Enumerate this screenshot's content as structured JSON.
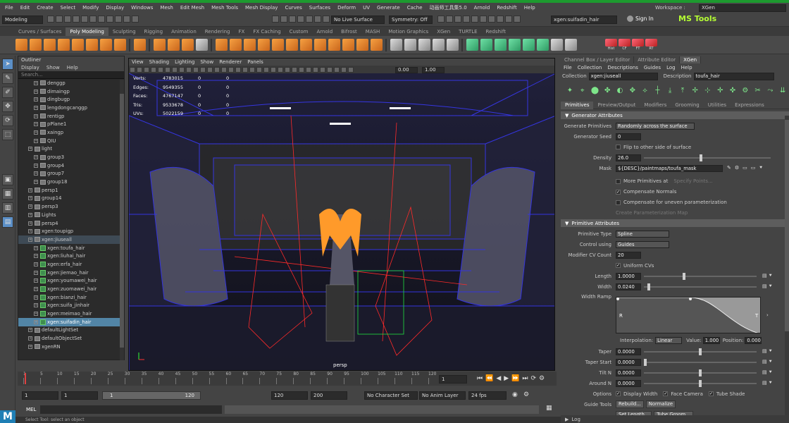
{
  "menubar": {
    "items": [
      "File",
      "Edit",
      "Create",
      "Select",
      "Modify",
      "Display",
      "Windows",
      "Mesh",
      "Edit Mesh",
      "Mesh Tools",
      "Mesh Display",
      "Curves",
      "Surfaces",
      "Deform",
      "UV",
      "Generate",
      "Cache",
      "动画师工具集5.0",
      "Arnold",
      "Redshift",
      "Help"
    ],
    "workspace_label": "Workspace :",
    "workspace_value": "XGen"
  },
  "statusline": {
    "mode": "Modeling",
    "live_surface": "No Live Surface",
    "symmetry": "Symmetry: Off",
    "search_field": "xgen:suifadin_hair",
    "sign_in": "Sign In",
    "brand": "MS Tools"
  },
  "shelf_tabs": [
    "Curves / Surfaces",
    "Poly Modeling",
    "Sculpting",
    "Rigging",
    "Animation",
    "Rendering",
    "FX",
    "FX Caching",
    "Custom",
    "Arnold",
    "Bifrost",
    "MASH",
    "Motion Graphics",
    "XGen",
    "TURTLE",
    "Redshift"
  ],
  "shelf_active": "Poly Modeling",
  "shelf_right_labels": [
    "Hist",
    "CF",
    "FT",
    "RT"
  ],
  "outliner": {
    "title": "Outliner",
    "menu": [
      "Display",
      "Show",
      "Help"
    ],
    "search_placeholder": "Search...",
    "items": [
      {
        "label": "denggp",
        "indent": 1,
        "kind": "group"
      },
      {
        "label": "dimaingp",
        "indent": 1,
        "kind": "group"
      },
      {
        "label": "dingbugp",
        "indent": 1,
        "kind": "group"
      },
      {
        "label": "lengdongcanggp",
        "indent": 1,
        "kind": "group"
      },
      {
        "label": "rentigp",
        "indent": 1,
        "kind": "group"
      },
      {
        "label": "pPlane1",
        "indent": 1,
        "kind": "group"
      },
      {
        "label": "xaingp",
        "indent": 1,
        "kind": "group"
      },
      {
        "label": "QIU",
        "indent": 1,
        "kind": "group"
      },
      {
        "label": "light",
        "indent": 0,
        "kind": "group"
      },
      {
        "label": "group3",
        "indent": 1,
        "kind": "group"
      },
      {
        "label": "group4",
        "indent": 1,
        "kind": "group"
      },
      {
        "label": "group7",
        "indent": 1,
        "kind": "group"
      },
      {
        "label": "group18",
        "indent": 1,
        "kind": "group"
      },
      {
        "label": "persp1",
        "indent": 0,
        "kind": "camera"
      },
      {
        "label": "group14",
        "indent": 0,
        "kind": "group"
      },
      {
        "label": "persp3",
        "indent": 0,
        "kind": "camera"
      },
      {
        "label": "Lights",
        "indent": 0,
        "kind": "group"
      },
      {
        "label": "persp4",
        "indent": 0,
        "kind": "camera"
      },
      {
        "label": "xgen:toupigp",
        "indent": 0,
        "kind": "group"
      },
      {
        "label": "xgen:jiuseall",
        "indent": 0,
        "kind": "group",
        "highlight": "soft"
      },
      {
        "label": "xgen:toufa_hair",
        "indent": 1,
        "kind": "xgen"
      },
      {
        "label": "xgen:liuhai_hair",
        "indent": 1,
        "kind": "xgen"
      },
      {
        "label": "xgen:erfa_hair",
        "indent": 1,
        "kind": "xgen"
      },
      {
        "label": "xgen:jiemao_hair",
        "indent": 1,
        "kind": "xgen"
      },
      {
        "label": "xgen:youmawei_hair",
        "indent": 1,
        "kind": "xgen"
      },
      {
        "label": "xgen:zuomawei_hair",
        "indent": 1,
        "kind": "xgen"
      },
      {
        "label": "xgen:bianzi_hair",
        "indent": 1,
        "kind": "xgen"
      },
      {
        "label": "xgen:suifa_jinhair",
        "indent": 1,
        "kind": "xgen"
      },
      {
        "label": "xgen:meimao_hair",
        "indent": 1,
        "kind": "xgen"
      },
      {
        "label": "xgen:suifadin_hair",
        "indent": 1,
        "kind": "xgen",
        "highlight": "sel"
      },
      {
        "label": "defaultLightSet",
        "indent": 0,
        "kind": "set"
      },
      {
        "label": "defaultObjectSet",
        "indent": 0,
        "kind": "set"
      },
      {
        "label": "xgenRN",
        "indent": 0,
        "kind": "ref"
      }
    ]
  },
  "viewport": {
    "menu": [
      "View",
      "Shading",
      "Lighting",
      "Show",
      "Renderer",
      "Panels"
    ],
    "field1": "0.00",
    "field2": "1.00",
    "hud": [
      {
        "label": "Verts:",
        "value": "4783015",
        "v2": "0",
        "v3": "0"
      },
      {
        "label": "Edges:",
        "value": "9549355",
        "v2": "0",
        "v3": "0"
      },
      {
        "label": "Faces:",
        "value": "4767147",
        "v2": "0",
        "v3": "0"
      },
      {
        "label": "Tris:",
        "value": "9533678",
        "v2": "0",
        "v3": "0"
      },
      {
        "label": "UVs:",
        "value": "5022159",
        "v2": "0",
        "v3": "0"
      }
    ],
    "camera_label": "persp"
  },
  "timeline": {
    "ticks": [
      "1",
      "5",
      "10",
      "15",
      "20",
      "25",
      "30",
      "35",
      "40",
      "45",
      "50",
      "55",
      "60",
      "65",
      "70",
      "75",
      "80",
      "85",
      "90",
      "95",
      "100",
      "105",
      "110",
      "115",
      "120"
    ],
    "current_frame": "1"
  },
  "range": {
    "start": "1",
    "start2": "1",
    "slider_left": "1",
    "slider_right": "120",
    "end": "120",
    "end2": "200",
    "character_set": "No Character Set",
    "anim_layer": "No Anim Layer",
    "fps": "24 fps"
  },
  "mel": {
    "label": "MEL"
  },
  "help_line": "Select Tool: select an object",
  "right_panel": {
    "tabs": [
      "Channel Box / Layer Editor",
      "Attribute Editor",
      "XGen"
    ],
    "active_tab": "XGen",
    "menu": [
      "File",
      "Collection",
      "Descriptions",
      "Guides",
      "Log",
      "Help"
    ],
    "collection_label": "Collection",
    "collection_value": "xgen:jiuseall",
    "description_label": "Description",
    "description_value": "toufa_hair",
    "subtabs": [
      "Primitives",
      "Preview/Output",
      "Modifiers",
      "Grooming",
      "Utilities",
      "Expressions"
    ],
    "active_subtab": "Primitives",
    "generator": {
      "section": "Generator Attributes",
      "generate_label": "Generate Primitives",
      "generate_value": "Randomly across the surface",
      "seed_label": "Generator Seed",
      "seed_value": "0",
      "flip_label": "Flip to other side of surface",
      "density_label": "Density",
      "density_value": "26.0",
      "density_fraction": 0.45,
      "mask_label": "Mask",
      "mask_value": "${DESC}/paintmaps/toufa_mask",
      "more_prims_label": "More Primitives at",
      "specify_points": "Specify Points...",
      "comp_normals_label": "Compensate Normals",
      "comp_uneven_label": "Compensate for uneven parameterization",
      "create_param_map": "Create Parameterization Map"
    },
    "primitive": {
      "section": "Primitive Attributes",
      "type_label": "Primitive Type",
      "type_value": "Spline",
      "control_label": "Control using",
      "control_value": "Guides",
      "cv_label": "Modifier CV Count",
      "cv_value": "20",
      "uniform_label": "Uniform CVs",
      "length_label": "Length",
      "length_value": "1.0000",
      "length_fraction": 0.35,
      "width_label": "Width",
      "width_value": "0.0240",
      "width_fraction": 0.03,
      "ramp_label": "Width Ramp",
      "ramp_left": "R",
      "ramp_right": "T",
      "interp_label": "Interpolation:",
      "interp_value": "Linear",
      "value_label": "Value:",
      "value_value": "1.000",
      "position_label": "Position:",
      "position_value": "0.000",
      "taper_label": "Taper",
      "taper_value": "0.0000",
      "taper_start_label": "Taper Start",
      "taper_start_value": "0.0000",
      "tilt_label": "Tilt N",
      "tilt_value": "0.0000",
      "around_label": "Around N",
      "around_value": "0.0000",
      "options_label": "Options",
      "display_width": "Display Width",
      "face_camera": "Face Camera",
      "tube_shade": "Tube Shade",
      "guide_tools_label": "Guide Tools",
      "rebuild": "Rebuild...",
      "normalize": "Normalize",
      "set_length": "Set Length...",
      "tube_groom": "Tube Groom..."
    },
    "log_label": "Log"
  },
  "colors": {
    "accent": "#5285a6",
    "title_bar": "#1d9a2f",
    "shelf_icon": "#f6a142",
    "xgen_icon": "#7ee58a",
    "wire_blue": "#3a3aff",
    "wire_red": "#ff2a2a",
    "hair": "#ff9a2a"
  }
}
